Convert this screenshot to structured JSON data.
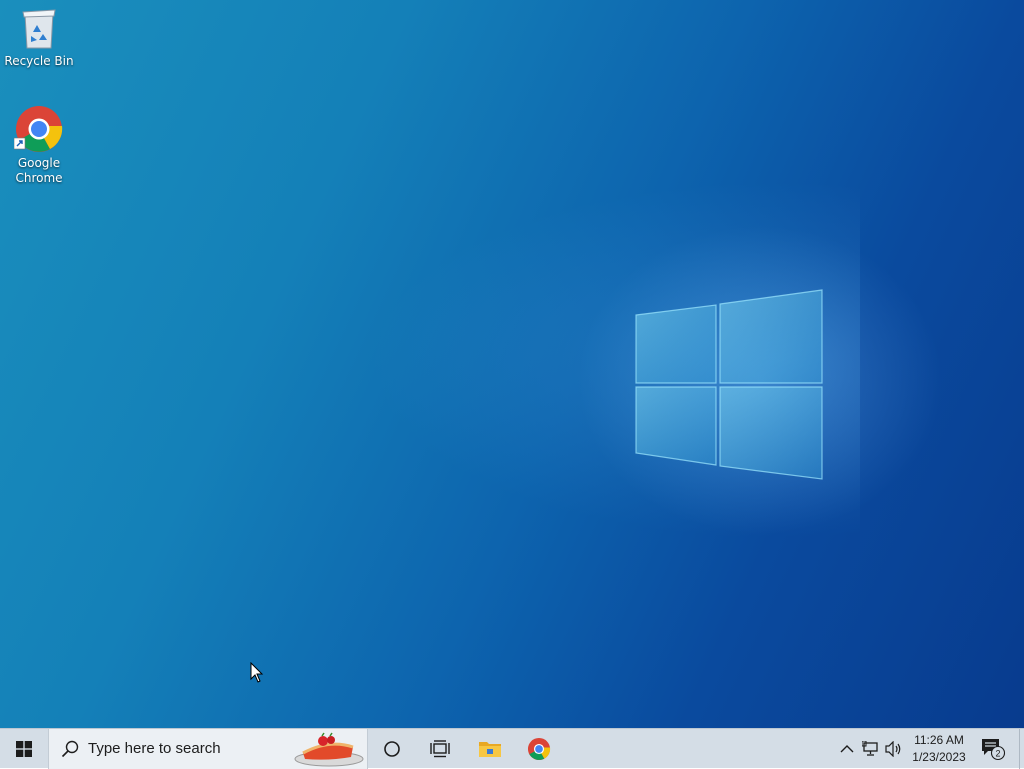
{
  "desktop": {
    "icons": [
      {
        "label": "Recycle Bin",
        "icon": "recycle-bin-icon"
      },
      {
        "label": "Google\nChrome",
        "icon": "chrome-icon"
      }
    ]
  },
  "taskbar": {
    "search_placeholder": "Type here to search",
    "pinned": [
      "cortana-icon",
      "task-view-icon",
      "file-explorer-icon",
      "chrome-icon"
    ],
    "clock": {
      "time": "11:26 AM",
      "date": "1/23/2023"
    },
    "notification_count": "2"
  },
  "colors": {
    "taskbar_bg": "#d4dde6",
    "desktop_blue": "#0d64ae",
    "chrome_red": "#db4437",
    "chrome_yellow": "#f4c20d",
    "chrome_green": "#0f9d58",
    "chrome_blue": "#4285f4"
  }
}
